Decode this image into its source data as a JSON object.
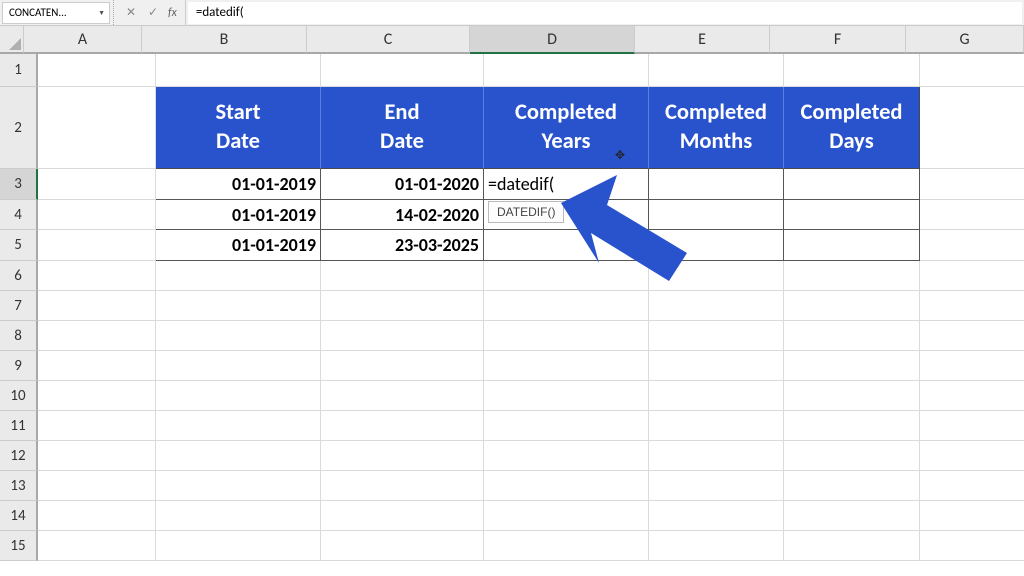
{
  "name_box": "CONCATEN...",
  "formula_input": "=datedif(",
  "columns": [
    "A",
    "B",
    "C",
    "D",
    "E",
    "F",
    "G"
  ],
  "active_column_index": 3,
  "active_row": 3,
  "rows_visible": 15,
  "table": {
    "headers": {
      "B": "Start\nDate",
      "C": "End\nDate",
      "D": "Completed\nYears",
      "E": "Completed\nMonths",
      "F": "Completed\nDays"
    },
    "rows": [
      {
        "B": "01-01-2019",
        "C": "01-01-2020"
      },
      {
        "B": "01-01-2019",
        "C": "14-02-2020"
      },
      {
        "B": "01-01-2019",
        "C": "23-03-2025"
      }
    ]
  },
  "editing_cell_text": "=datedif(",
  "tooltip": "DATEDIF()",
  "colors": {
    "header_blue": "#2953cc",
    "arrow_blue": "#2953cc"
  }
}
